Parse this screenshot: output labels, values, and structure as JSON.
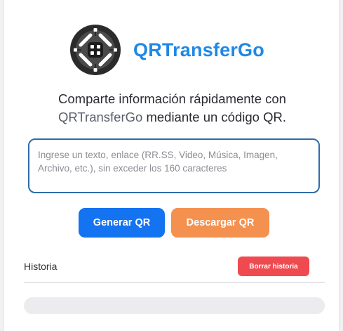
{
  "app": {
    "name": "QRTransferGo",
    "logo_icon": "qr-lock-icon",
    "accent_color": "#1e88e5"
  },
  "tagline": {
    "line1": "Comparte información rápidamente con",
    "line2_accent": "QRTransferGo",
    "line2_rest": " mediante un código QR."
  },
  "input": {
    "value": "",
    "placeholder": "Ingrese un texto, enlace (RR.SS, Video, Música, Imagen, Archivo, etc.), sin exceder los 160 caracteres"
  },
  "buttons": {
    "generate": "Generar QR",
    "download": "Descargar QR"
  },
  "history": {
    "title": "Historia",
    "clear_button": "Borrar historia",
    "items": []
  },
  "colors": {
    "generate_bg": "#1473f0",
    "download_bg": "#f5914f",
    "clear_bg": "#ef4a4f",
    "input_border": "#2f6da8"
  }
}
